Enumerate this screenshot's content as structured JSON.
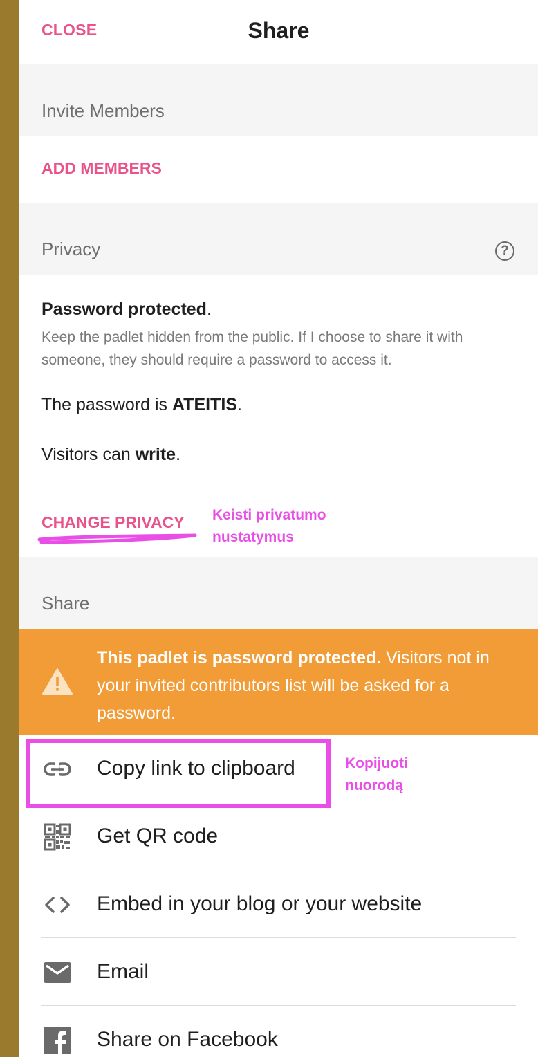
{
  "header": {
    "close_label": "CLOSE",
    "title": "Share"
  },
  "invite": {
    "section_label": "Invite Members",
    "add_label": "ADD MEMBERS"
  },
  "privacy": {
    "section_label": "Privacy",
    "help_icon": "question-circle-icon",
    "mode_title": "Password protected",
    "mode_title_suffix": ".",
    "mode_description": "Keep the padlet hidden from the public. If I choose to share it with someone, they should require a password to access it.",
    "password_prefix": "The password is ",
    "password_value": "ATEITIS",
    "password_suffix": ".",
    "visitors_prefix": "Visitors can ",
    "visitors_value": "write",
    "visitors_suffix": ".",
    "change_label": "CHANGE PRIVACY",
    "annotation_line1": "Keisti privatumo",
    "annotation_line2": "nustatymus"
  },
  "share": {
    "section_label": "Share",
    "warning_bold": "This padlet is password protected.",
    "warning_text": " Visitors not in your invited contributors list will be asked for a password.",
    "warning_icon": "warning-triangle-icon",
    "copy_annotation_line1": "Kopijuoti",
    "copy_annotation_line2": "nuorodą",
    "items": [
      {
        "label": "Copy link to clipboard",
        "icon": "link-icon"
      },
      {
        "label": "Get QR code",
        "icon": "qr-code-icon"
      },
      {
        "label": "Embed in your blog or your website",
        "icon": "code-icon"
      },
      {
        "label": "Email",
        "icon": "envelope-icon"
      },
      {
        "label": "Share on Facebook",
        "icon": "facebook-icon"
      }
    ]
  },
  "colors": {
    "accent": "#e8538a",
    "annotation": "#e94fe6",
    "warning": "#f29c38",
    "left_strip": "#9a7a2c",
    "section_bg": "#f5f5f5"
  }
}
